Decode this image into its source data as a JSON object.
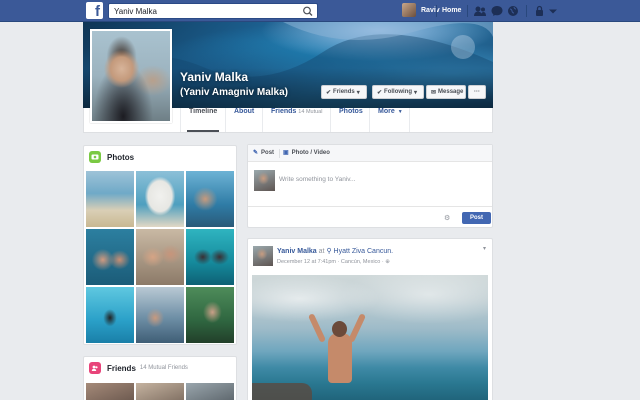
{
  "topbar": {
    "logo": "f",
    "search_value": "Yaniv Malka",
    "user_name": "Raviv",
    "home_label": "Home"
  },
  "profile": {
    "name": "Yaniv Malka",
    "alt_name": "(Yaniv Amagniv Malka)",
    "buttons": {
      "friends": "Friends",
      "following": "Following",
      "message": "Message",
      "more": "···"
    }
  },
  "timeline_nav": {
    "tabs": [
      {
        "label": "Timeline",
        "active": true
      },
      {
        "label": "About"
      },
      {
        "label": "Friends",
        "sub": "14 Mutual"
      },
      {
        "label": "Photos"
      },
      {
        "label": "More"
      }
    ]
  },
  "photos_card": {
    "title": "Photos"
  },
  "friends_card": {
    "title": "Friends",
    "sub": "14 Mutual Friends"
  },
  "composer": {
    "tab_post": "Post",
    "tab_photo": "Photo / Video",
    "placeholder": "Write something to Yaniv...",
    "post_button": "Post"
  },
  "feed_post": {
    "author": "Yaniv Malka",
    "at_word": "at",
    "place": "Hyatt Ziva Cancun.",
    "date": "December 12 at 7:41pm",
    "location": "Cancún, Mexico"
  },
  "colors": {
    "brand": "#3b5998",
    "link": "#365899",
    "button": "#4267b2",
    "background": "#e9ebee"
  }
}
